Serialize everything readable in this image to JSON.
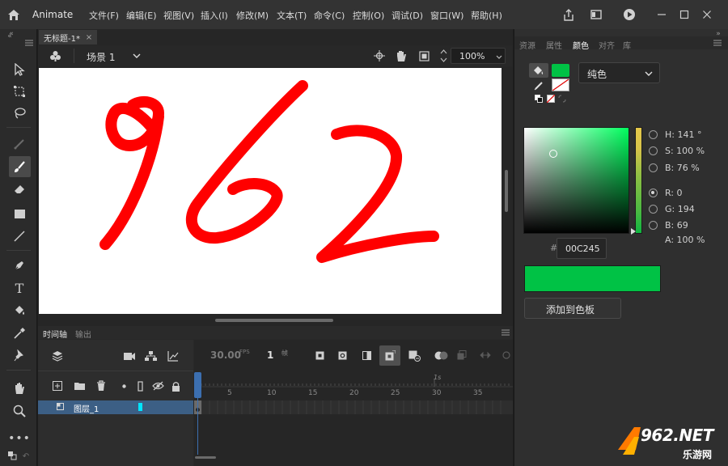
{
  "app": {
    "name": "Animate"
  },
  "menu": [
    "文件(F)",
    "编辑(E)",
    "视图(V)",
    "插入(I)",
    "修改(M)",
    "文本(T)",
    "命令(C)",
    "控制(O)",
    "调试(D)",
    "窗口(W)",
    "帮助(H)"
  ],
  "document": {
    "tab_title": "无标题-1*",
    "scene": "场景 1",
    "zoom": "100%",
    "stage_text": "962"
  },
  "timeline": {
    "tabs": [
      "时间轴",
      "输出"
    ],
    "fps": "30.00",
    "fps_unit": "FPS",
    "current_frame": "1",
    "frame_unit": "帧",
    "ruler_marks": [
      "5",
      "10",
      "15",
      "20",
      "25",
      "30",
      "35"
    ],
    "second_mark": "1s",
    "layer_name": "图层_1"
  },
  "panel": {
    "tabs": [
      "资源",
      "属性",
      "颜色",
      "对齐",
      "库"
    ],
    "fill_type": "纯色",
    "hsb": {
      "h": "H: 141 °",
      "s": "S: 100 %",
      "b": "B: 76 %"
    },
    "rgb": {
      "r": "R: 0",
      "g": "G: 194",
      "b": "B: 69",
      "a": "A: 100 %"
    },
    "hex_prefix": "#",
    "hex": "00C245",
    "add_swatch": "添加到色板",
    "color": "#00c245"
  },
  "watermark": {
    "text": "962.NET",
    "sub": "乐游网"
  }
}
